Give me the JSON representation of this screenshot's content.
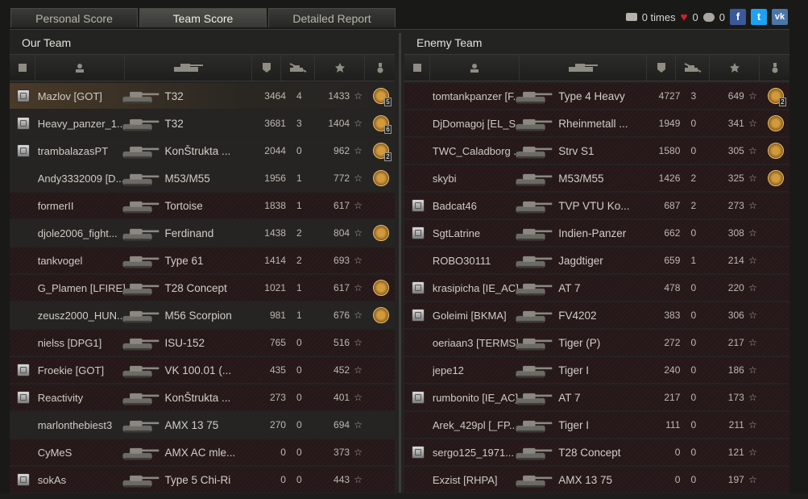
{
  "tabs": [
    "Personal Score",
    "Team Score",
    "Detailed Report"
  ],
  "active_tab": "Team Score",
  "topbar": {
    "views_label": "0 times",
    "likes": "0",
    "comments": "0"
  },
  "teams": {
    "our": {
      "title": "Our Team",
      "players": [
        {
          "name": "Mazlov [GOT]",
          "tank": "T32",
          "dmg": "3464",
          "kills": "4",
          "xp": "1433",
          "medal": true,
          "medal_count": "5",
          "rank": true,
          "state": "me"
        },
        {
          "name": "Heavy_panzer_1...",
          "tank": "T32",
          "dmg": "3681",
          "kills": "3",
          "xp": "1404",
          "medal": true,
          "medal_count": "6",
          "rank": true,
          "state": "alive"
        },
        {
          "name": "trambalazasPT",
          "tank": "KonŠtrukta ...",
          "dmg": "2044",
          "kills": "0",
          "xp": "962",
          "medal": true,
          "medal_count": "2",
          "rank": true,
          "state": "alive"
        },
        {
          "name": "Andy3332009 [D...",
          "tank": "M53/M55",
          "dmg": "1956",
          "kills": "1",
          "xp": "772",
          "medal": true,
          "medal_count": "",
          "rank": false,
          "state": "alive"
        },
        {
          "name": "formerII",
          "tank": "Tortoise",
          "dmg": "1838",
          "kills": "1",
          "xp": "617",
          "medal": false,
          "medal_count": "",
          "rank": false,
          "state": "dead"
        },
        {
          "name": "djole2006_fight...",
          "tank": "Ferdinand",
          "dmg": "1438",
          "kills": "2",
          "xp": "804",
          "medal": true,
          "medal_count": "",
          "rank": false,
          "state": "alive"
        },
        {
          "name": "tankvogel",
          "tank": "Type 61",
          "dmg": "1414",
          "kills": "2",
          "xp": "693",
          "medal": false,
          "medal_count": "",
          "rank": false,
          "state": "dead"
        },
        {
          "name": "G_Plamen [LFIRE]",
          "tank": "T28 Concept",
          "dmg": "1021",
          "kills": "1",
          "xp": "617",
          "medal": true,
          "medal_count": "",
          "rank": false,
          "state": "dead"
        },
        {
          "name": "zeusz2000_HUN...",
          "tank": "M56 Scorpion",
          "dmg": "981",
          "kills": "1",
          "xp": "676",
          "medal": true,
          "medal_count": "",
          "rank": false,
          "state": "alive"
        },
        {
          "name": "nielss [DPG1]",
          "tank": "ISU-152",
          "dmg": "765",
          "kills": "0",
          "xp": "516",
          "medal": false,
          "medal_count": "",
          "rank": false,
          "state": "dead"
        },
        {
          "name": "Froekie [GOT]",
          "tank": "VK 100.01 (...",
          "dmg": "435",
          "kills": "0",
          "xp": "452",
          "medal": false,
          "medal_count": "",
          "rank": true,
          "state": "dead"
        },
        {
          "name": "Reactivity",
          "tank": "KonŠtrukta ...",
          "dmg": "273",
          "kills": "0",
          "xp": "401",
          "medal": false,
          "medal_count": "",
          "rank": true,
          "state": "dead"
        },
        {
          "name": "marlonthebiest3",
          "tank": "AMX 13 75",
          "dmg": "270",
          "kills": "0",
          "xp": "694",
          "medal": false,
          "medal_count": "",
          "rank": false,
          "state": "alive"
        },
        {
          "name": "CyMeS",
          "tank": "AMX AC mle...",
          "dmg": "0",
          "kills": "0",
          "xp": "373",
          "medal": false,
          "medal_count": "",
          "rank": false,
          "state": "dead"
        },
        {
          "name": "sokAs",
          "tank": "Type 5 Chi-Ri",
          "dmg": "0",
          "kills": "0",
          "xp": "443",
          "medal": false,
          "medal_count": "",
          "rank": true,
          "state": "dead"
        }
      ]
    },
    "enemy": {
      "title": "Enemy Team",
      "players": [
        {
          "name": "tomtankpanzer [F...",
          "tank": "Type 4 Heavy",
          "dmg": "4727",
          "kills": "3",
          "xp": "649",
          "medal": true,
          "medal_count": "2",
          "rank": false,
          "state": "dead"
        },
        {
          "name": "DjDomagoj [EL_S...",
          "tank": "Rheinmetall ...",
          "dmg": "1949",
          "kills": "0",
          "xp": "341",
          "medal": true,
          "medal_count": "",
          "rank": false,
          "state": "dead"
        },
        {
          "name": "TWC_Caladborg ...",
          "tank": "Strv S1",
          "dmg": "1580",
          "kills": "0",
          "xp": "305",
          "medal": true,
          "medal_count": "",
          "rank": false,
          "state": "dead"
        },
        {
          "name": "skybi",
          "tank": "M53/M55",
          "dmg": "1426",
          "kills": "2",
          "xp": "325",
          "medal": true,
          "medal_count": "",
          "rank": false,
          "state": "dead"
        },
        {
          "name": "Badcat46",
          "tank": "TVP VTU Ko...",
          "dmg": "687",
          "kills": "2",
          "xp": "273",
          "medal": false,
          "medal_count": "",
          "rank": true,
          "state": "dead"
        },
        {
          "name": "SgtLatrine",
          "tank": "Indien-Panzer",
          "dmg": "662",
          "kills": "0",
          "xp": "308",
          "medal": false,
          "medal_count": "",
          "rank": true,
          "state": "dead"
        },
        {
          "name": "ROBO30111",
          "tank": "Jagdtiger",
          "dmg": "659",
          "kills": "1",
          "xp": "214",
          "medal": false,
          "medal_count": "",
          "rank": false,
          "state": "dead"
        },
        {
          "name": "krasipicha [IE_AC]",
          "tank": "AT 7",
          "dmg": "478",
          "kills": "0",
          "xp": "220",
          "medal": false,
          "medal_count": "",
          "rank": true,
          "state": "dead"
        },
        {
          "name": "Goleimi [BKMA]",
          "tank": "FV4202",
          "dmg": "383",
          "kills": "0",
          "xp": "306",
          "medal": false,
          "medal_count": "",
          "rank": true,
          "state": "dead"
        },
        {
          "name": "oeriaan3 [TERMS]",
          "tank": "Tiger (P)",
          "dmg": "272",
          "kills": "0",
          "xp": "217",
          "medal": false,
          "medal_count": "",
          "rank": false,
          "state": "dead"
        },
        {
          "name": "jepe12",
          "tank": "Tiger I",
          "dmg": "240",
          "kills": "0",
          "xp": "186",
          "medal": false,
          "medal_count": "",
          "rank": false,
          "state": "dead"
        },
        {
          "name": "rumbonito [IE_AC]",
          "tank": "AT 7",
          "dmg": "217",
          "kills": "0",
          "xp": "173",
          "medal": false,
          "medal_count": "",
          "rank": true,
          "state": "dead"
        },
        {
          "name": "Arek_429pl [_FP...",
          "tank": "Tiger I",
          "dmg": "111",
          "kills": "0",
          "xp": "211",
          "medal": false,
          "medal_count": "",
          "rank": false,
          "state": "dead"
        },
        {
          "name": "sergo125_1971...",
          "tank": "T28 Concept",
          "dmg": "0",
          "kills": "0",
          "xp": "121",
          "medal": false,
          "medal_count": "",
          "rank": true,
          "state": "dead"
        },
        {
          "name": "Exzist [RHPA]",
          "tank": "AMX 13 75",
          "dmg": "0",
          "kills": "0",
          "xp": "197",
          "medal": false,
          "medal_count": "",
          "rank": false,
          "state": "dead"
        }
      ]
    }
  },
  "colors": {
    "dead_row": "#2a1b1c",
    "alive_row": "#262423",
    "me_row": "#4a3a28",
    "heart": "#c9252c"
  },
  "icons": {
    "header": [
      "rank-icon",
      "player-icon",
      "tank-icon",
      "damage-shield-icon",
      "kills-icon",
      "experience-star-icon",
      "medal-icon"
    ],
    "topbar": [
      "camera-icon",
      "heart-icon",
      "comment-icon",
      "facebook-icon",
      "twitter-icon",
      "vk-icon"
    ]
  }
}
